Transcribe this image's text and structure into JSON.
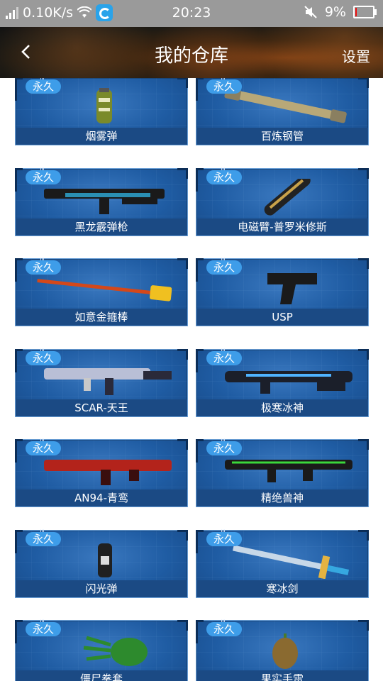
{
  "status_bar": {
    "speed": "0.10K/s",
    "time": "20:23",
    "battery": "9%",
    "battery_level": 0.09
  },
  "header": {
    "back_icon": "chevron-left-icon",
    "title": "我的仓库",
    "settings_label": "设置"
  },
  "items": [
    {
      "badge": "永久",
      "name": "烟雾弹",
      "icon": "smoke-grenade-icon",
      "color": "#7a8a2a"
    },
    {
      "badge": "永久",
      "name": "百炼钢管",
      "icon": "steel-pipe-icon",
      "color": "#b8a878"
    },
    {
      "badge": "永久",
      "name": "黑龙霰弹枪",
      "icon": "shotgun-icon",
      "color": "#1a1a1a"
    },
    {
      "badge": "永久",
      "name": "电磁臂-普罗米修斯",
      "icon": "electromagnetic-arm-icon",
      "color": "#222222"
    },
    {
      "badge": "永久",
      "name": "如意金箍棒",
      "icon": "golden-staff-icon",
      "color": "#d4481a"
    },
    {
      "badge": "永久",
      "name": "USP",
      "icon": "pistol-icon",
      "color": "#1a1a1a"
    },
    {
      "badge": "永久",
      "name": "SCAR-天王",
      "icon": "rifle-icon",
      "color": "#2a2a3a"
    },
    {
      "badge": "永久",
      "name": "极寒冰神",
      "icon": "ice-rifle-icon",
      "color": "#1b1f2a"
    },
    {
      "badge": "永久",
      "name": "AN94-青鸾",
      "icon": "red-rifle-icon",
      "color": "#b3231b"
    },
    {
      "badge": "永久",
      "name": "精绝兽神",
      "icon": "green-rifle-icon",
      "color": "#2f4a1a"
    },
    {
      "badge": "永久",
      "name": "闪光弹",
      "icon": "flash-grenade-icon",
      "color": "#202020"
    },
    {
      "badge": "永久",
      "name": "寒冰剑",
      "icon": "ice-sword-icon",
      "color": "#c8d8e8"
    },
    {
      "badge": "永久",
      "name": "僵尸拳套",
      "icon": "zombie-claw-icon",
      "color": "#2d8a2d"
    },
    {
      "badge": "永久",
      "name": "果实手雷",
      "icon": "fruit-grenade-icon",
      "color": "#8a6a30"
    }
  ]
}
